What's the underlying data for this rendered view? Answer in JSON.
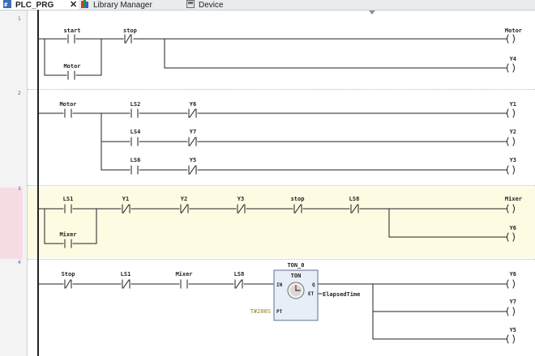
{
  "tabs": [
    {
      "label": "PLC_PRG",
      "close": "✕"
    },
    {
      "label": "Library Manager"
    },
    {
      "label": "Device"
    }
  ],
  "networks": [
    {
      "number": "1",
      "contacts": [
        {
          "label": "start",
          "type": "NO"
        },
        {
          "label": "stop",
          "type": "NC"
        },
        {
          "label": "Motor",
          "type": "NO"
        }
      ],
      "coils": [
        "Motor",
        "Y4"
      ]
    },
    {
      "number": "2",
      "contacts": [
        {
          "label": "Motor",
          "type": "NO"
        },
        {
          "label": "LS2",
          "type": "NO"
        },
        {
          "label": "Y6",
          "type": "NC"
        },
        {
          "label": "LS4",
          "type": "NO"
        },
        {
          "label": "Y7",
          "type": "NC"
        },
        {
          "label": "LS6",
          "type": "NO"
        },
        {
          "label": "Y5",
          "type": "NC"
        }
      ],
      "coils": [
        "Y1",
        "Y2",
        "Y3"
      ]
    },
    {
      "number": "3",
      "contacts": [
        {
          "label": "LS1",
          "type": "NO"
        },
        {
          "label": "Y1",
          "type": "NC"
        },
        {
          "label": "Y2",
          "type": "NC"
        },
        {
          "label": "Y3",
          "type": "NC"
        },
        {
          "label": "stop",
          "type": "NC"
        },
        {
          "label": "LS8",
          "type": "NC"
        },
        {
          "label": "Mixer",
          "type": "NO"
        }
      ],
      "coils": [
        "Mixer",
        "Y6"
      ]
    },
    {
      "number": "4",
      "contacts": [
        {
          "label": "Stop",
          "type": "NC"
        },
        {
          "label": "LS1",
          "type": "NC"
        },
        {
          "label": "Mixer",
          "type": "NO"
        },
        {
          "label": "LS8",
          "type": "NC"
        }
      ],
      "timer": {
        "instance": "TON_0",
        "type": "TON",
        "in_pin": "IN",
        "pt_pin": "PT",
        "q_pin": "Q",
        "et_pin": "ET",
        "pt_value": "T#200S",
        "et_output": "ElapsedTime"
      },
      "coils": [
        "Y6",
        "Y7",
        "Y5"
      ]
    }
  ]
}
